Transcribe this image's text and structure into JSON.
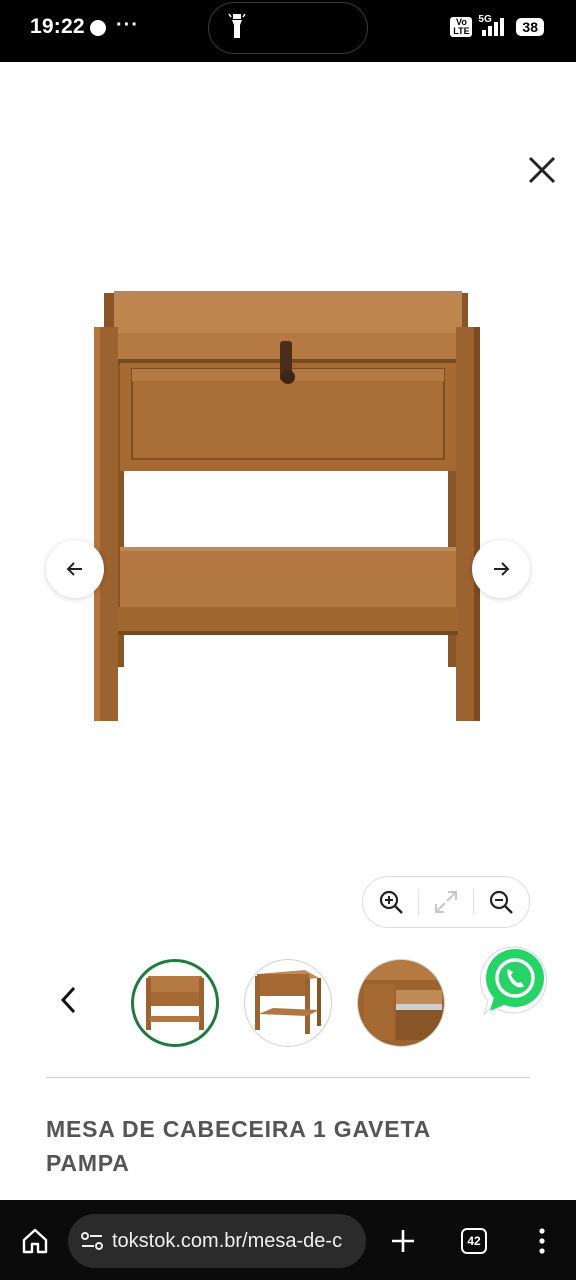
{
  "status_bar": {
    "time": "19:22",
    "more": "···",
    "volte": "Vo LTE",
    "network": "5G",
    "battery": "38"
  },
  "product": {
    "title": "MESA DE CABECEIRA 1 GAVETA PAMPA",
    "image": "wooden-nightstand-1-drawer"
  },
  "gallery": {
    "thumbnails": [
      {
        "name": "thumbnail-front-view",
        "selected": true
      },
      {
        "name": "thumbnail-angle-view",
        "selected": false
      },
      {
        "name": "thumbnail-drawer-detail",
        "selected": false
      }
    ],
    "active_color": "#1f7a3d"
  },
  "browser": {
    "url": "tokstok.com.br/mesa-de-c",
    "tab_count": "42"
  },
  "colors": {
    "whatsapp": "#25d366",
    "wood": "#a76a34"
  }
}
